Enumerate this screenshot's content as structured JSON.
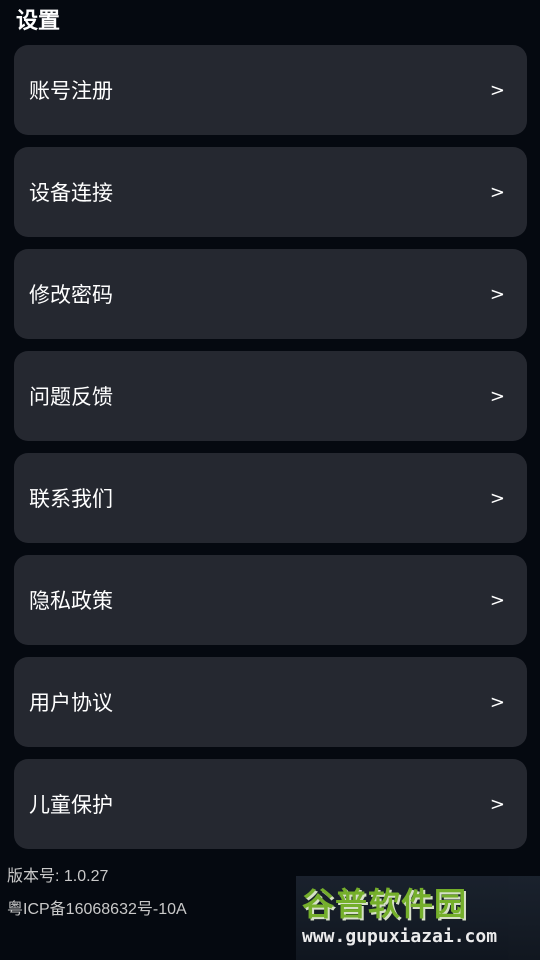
{
  "header": {
    "title": "设置"
  },
  "menu": {
    "items": [
      {
        "label": "账号注册",
        "chevron": ">"
      },
      {
        "label": "设备连接",
        "chevron": ">"
      },
      {
        "label": "修改密码",
        "chevron": ">"
      },
      {
        "label": "问题反馈",
        "chevron": ">"
      },
      {
        "label": "联系我们",
        "chevron": ">"
      },
      {
        "label": "隐私政策",
        "chevron": ">"
      },
      {
        "label": "用户协议",
        "chevron": ">"
      },
      {
        "label": "儿童保护",
        "chevron": ">"
      }
    ]
  },
  "footer": {
    "version": "版本号: 1.0.27",
    "icp": "粤ICP备16068632号-10A"
  },
  "watermark": {
    "title": "谷普软件园",
    "url": "www.gupuxiazai.com"
  },
  "colors": {
    "background": "#050910",
    "card": "#252830",
    "text": "#ffffff",
    "footer_text": "#c9c9c9",
    "watermark_green": "#7fbe2e"
  }
}
